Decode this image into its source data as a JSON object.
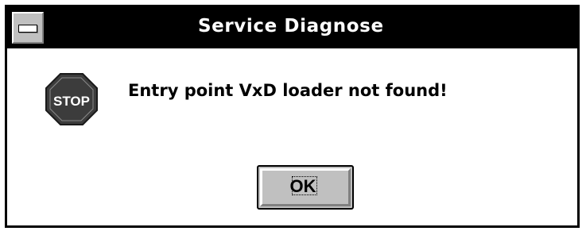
{
  "window": {
    "title": "Service Diagnose"
  },
  "dialog": {
    "icon": "stop-icon",
    "icon_label": "STOP",
    "message": "Entry point VxD loader not found!",
    "ok_label": "OK"
  },
  "colors": {
    "titlebar": "#000000",
    "button_face": "#c0c0c0",
    "stop_sign": "#3c3c3c"
  }
}
